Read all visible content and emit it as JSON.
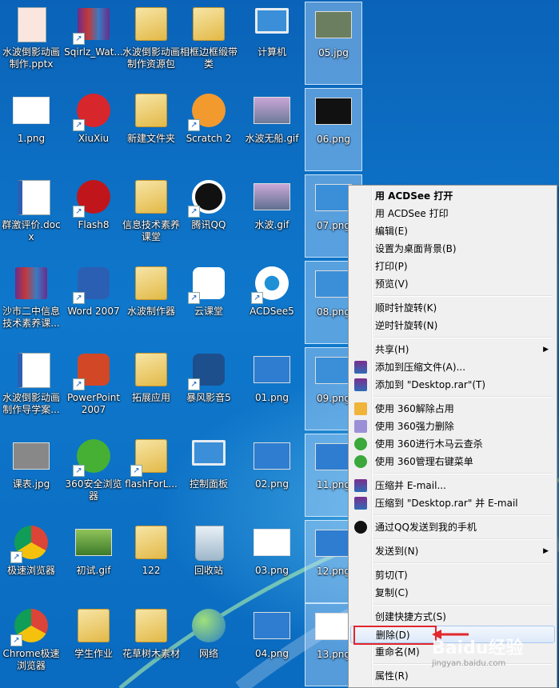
{
  "desktop": {
    "icons": [
      {
        "label": "水波倒影动画制作.pptx"
      },
      {
        "label": "Sqirlz_Wat..."
      },
      {
        "label": "水波倒影动画制作资源包"
      },
      {
        "label": "相框边框缎带类"
      },
      {
        "label": "计算机"
      },
      {
        "label": "05.jpg"
      },
      {
        "label": "1.png"
      },
      {
        "label": "XiuXiu"
      },
      {
        "label": "新建文件夹"
      },
      {
        "label": "Scratch 2"
      },
      {
        "label": "水波无船.gif"
      },
      {
        "label": "06.png"
      },
      {
        "label": "群激评价.docx"
      },
      {
        "label": "Flash8"
      },
      {
        "label": "信息技术素养课堂"
      },
      {
        "label": "腾讯QQ"
      },
      {
        "label": "水波.gif"
      },
      {
        "label": "07.png"
      },
      {
        "label": "沙市二中信息技术素养课..."
      },
      {
        "label": "Word 2007"
      },
      {
        "label": "水波制作器"
      },
      {
        "label": "云课堂"
      },
      {
        "label": "ACDSee5"
      },
      {
        "label": "08.png"
      },
      {
        "label": "水波倒影动画制作导学案..."
      },
      {
        "label": "PowerPoint 2007"
      },
      {
        "label": "拓展应用"
      },
      {
        "label": "暴风影音5"
      },
      {
        "label": "01.png"
      },
      {
        "label": "09.png"
      },
      {
        "label": "课表.jpg"
      },
      {
        "label": "360安全浏览器"
      },
      {
        "label": "flashForL..."
      },
      {
        "label": "控制面板"
      },
      {
        "label": "02.png"
      },
      {
        "label": "11.png"
      },
      {
        "label": "极速浏览器"
      },
      {
        "label": "初试.gif"
      },
      {
        "label": "122"
      },
      {
        "label": "回收站"
      },
      {
        "label": "03.png"
      },
      {
        "label": "12.png"
      },
      {
        "label": "Chrome极速浏览器"
      },
      {
        "label": "学生作业"
      },
      {
        "label": "花草树木素材"
      },
      {
        "label": "网络"
      },
      {
        "label": "04.png"
      },
      {
        "label": "13.png"
      }
    ]
  },
  "context_menu": {
    "items": [
      {
        "label": "用 ACDSee 打开"
      },
      {
        "label": "用 ACDSee 打印"
      },
      {
        "label": "编辑(E)"
      },
      {
        "label": "设置为桌面背景(B)"
      },
      {
        "label": "打印(P)"
      },
      {
        "label": "预览(V)"
      },
      {
        "label": "顺时针旋转(K)"
      },
      {
        "label": "逆时针旋转(N)"
      },
      {
        "label": "共享(H)"
      },
      {
        "label": "添加到压缩文件(A)..."
      },
      {
        "label": "添加到 \"Desktop.rar\"(T)"
      },
      {
        "label": "使用 360解除占用"
      },
      {
        "label": "使用 360强力删除"
      },
      {
        "label": "使用 360进行木马云查杀"
      },
      {
        "label": "使用 360管理右键菜单"
      },
      {
        "label": "压缩并 E-mail..."
      },
      {
        "label": "压缩到 \"Desktop.rar\" 并 E-mail"
      },
      {
        "label": "通过QQ发送到我的手机"
      },
      {
        "label": "发送到(N)"
      },
      {
        "label": "剪切(T)"
      },
      {
        "label": "复制(C)"
      },
      {
        "label": "创建快捷方式(S)"
      },
      {
        "label": "删除(D)"
      },
      {
        "label": "重命名(M)"
      },
      {
        "label": "属性(R)"
      }
    ],
    "submenu_glyph": "▶"
  },
  "watermark": {
    "text": "Baidu经验",
    "sub": "jingyan.baidu.com"
  },
  "colors": {
    "highlight_box": "#e3262b",
    "menu_bg": "#f0f0f0",
    "desktop": "#0f78cc"
  }
}
